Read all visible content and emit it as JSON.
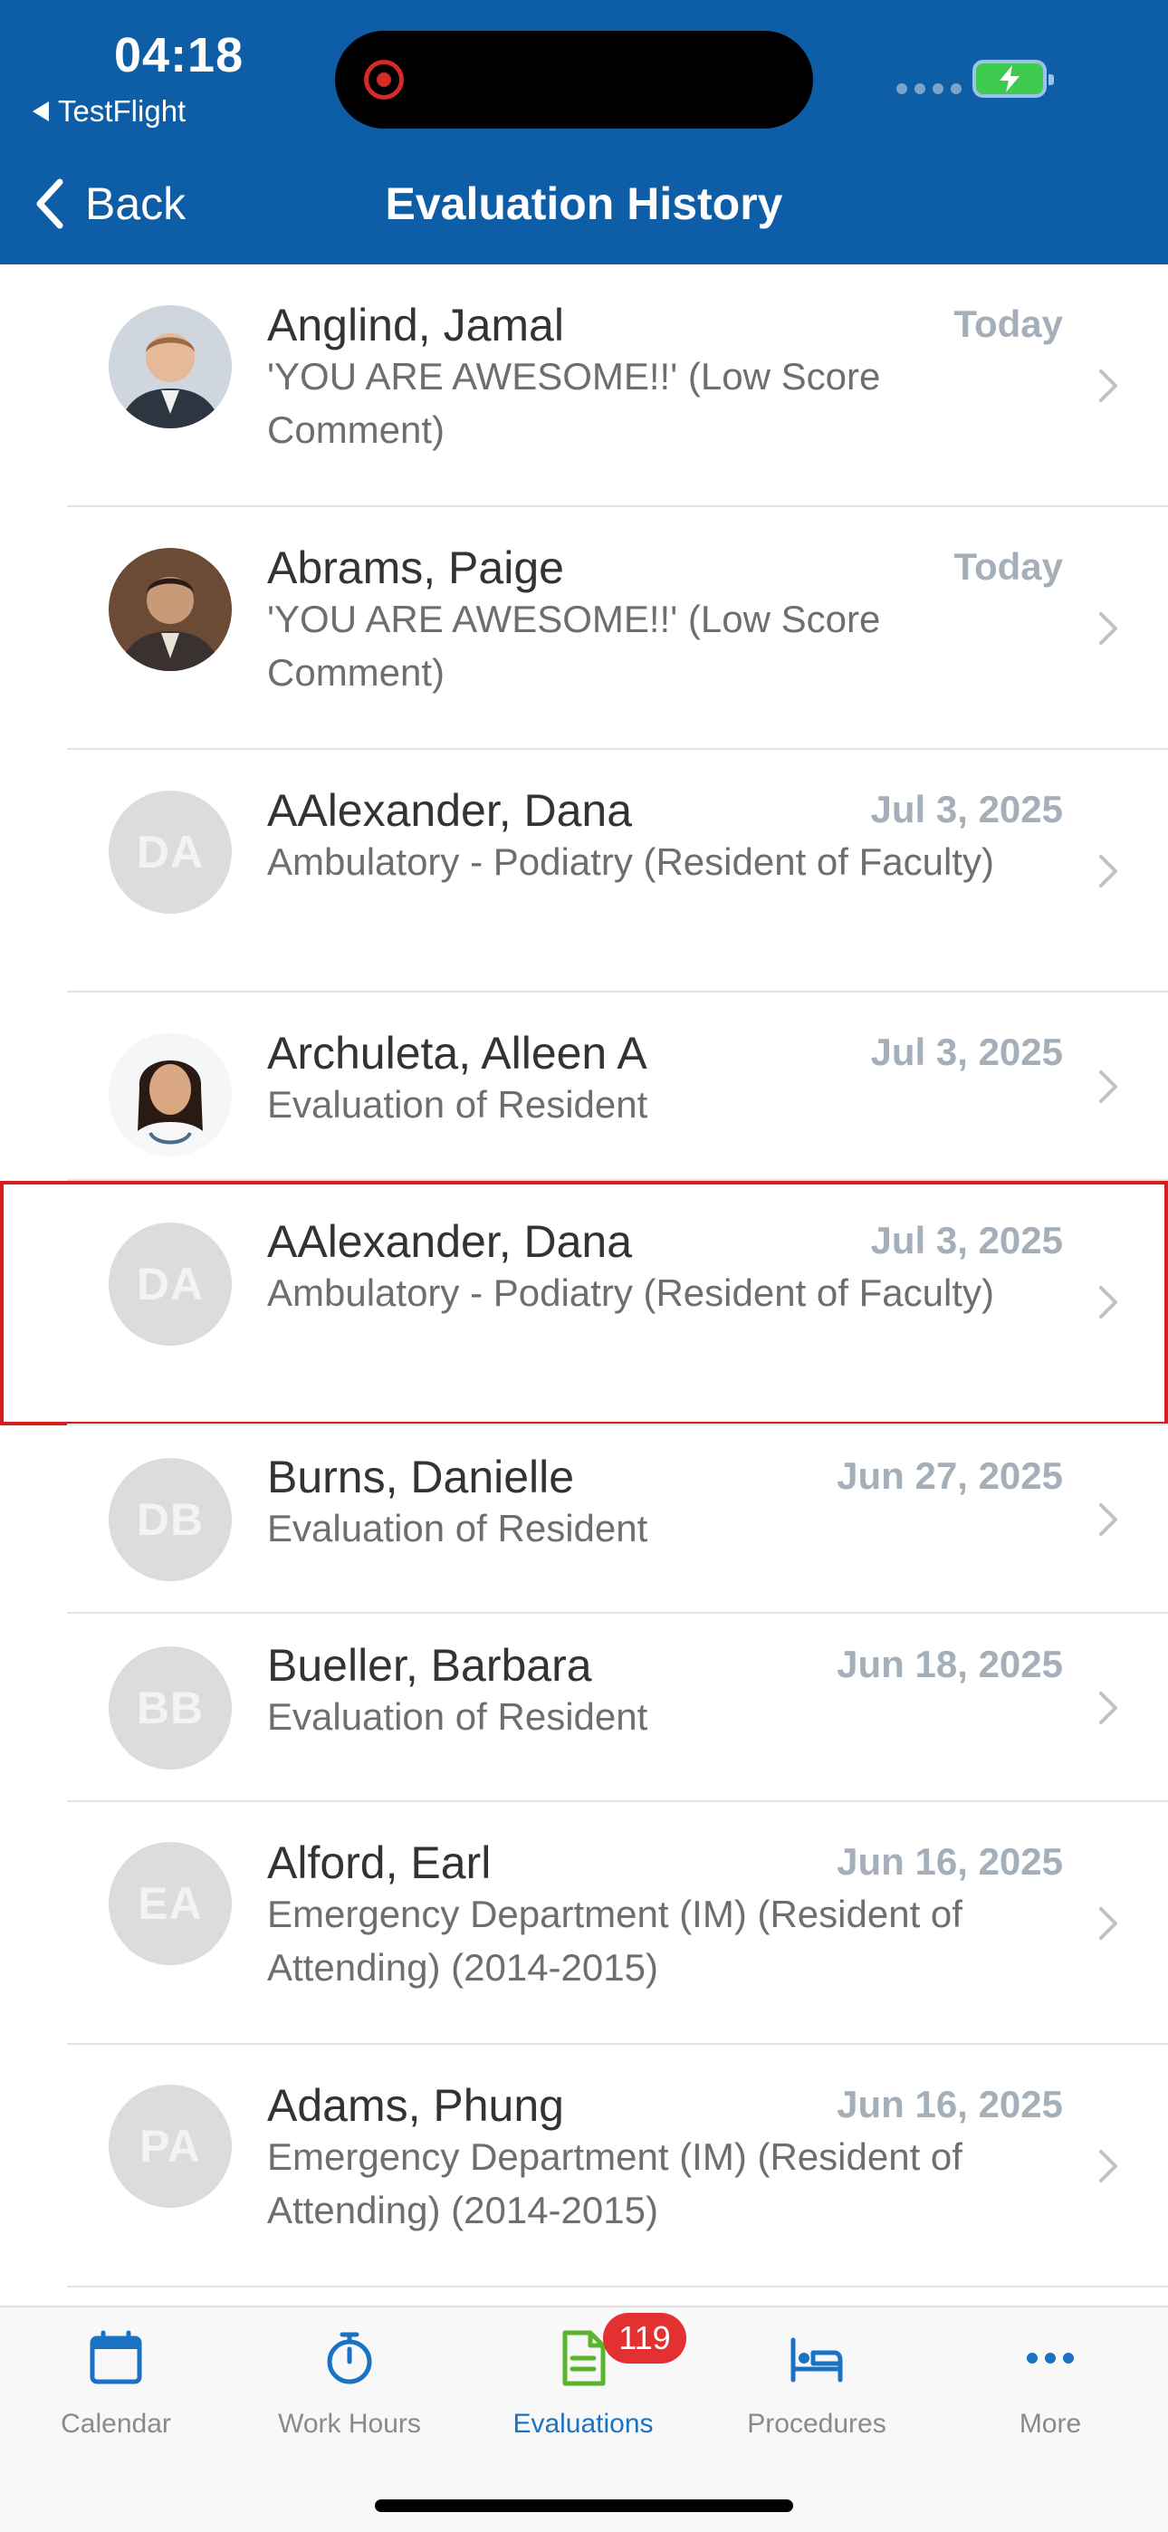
{
  "status_bar": {
    "time": "04:18",
    "back_app": "TestFlight"
  },
  "nav": {
    "back_label": "Back",
    "title": "Evaluation History"
  },
  "rows": [
    {
      "name": "Anglind, Jamal",
      "date": "Today",
      "subtitle": "'YOU ARE AWESOME!!'  (Low Score Comment)",
      "initials": "",
      "photo": "man-photo"
    },
    {
      "name": "Abrams, Paige",
      "date": "Today",
      "subtitle": "'YOU ARE AWESOME!!'  (Low Score Comment)",
      "initials": "",
      "photo": "man-photo"
    },
    {
      "name": "AAlexander, Dana",
      "date": "Jul 3, 2025",
      "subtitle": "Ambulatory - Podiatry (Resident of Faculty)",
      "initials": "DA"
    },
    {
      "name": "Archuleta, Alleen A",
      "date": "Jul 3, 2025",
      "subtitle": "Evaluation of Resident",
      "initials": "",
      "photo": "woman-photo"
    },
    {
      "name": "AAlexander, Dana",
      "date": "Jul 3, 2025",
      "subtitle": "Ambulatory - Podiatry (Resident of Faculty)",
      "initials": "DA"
    },
    {
      "name": "Burns, Danielle",
      "date": "Jun 27, 2025",
      "subtitle": "Evaluation of Resident",
      "initials": "DB"
    },
    {
      "name": "Bueller, Barbara",
      "date": "Jun 18, 2025",
      "subtitle": "Evaluation of Resident",
      "initials": "BB"
    },
    {
      "name": "Alford, Earl",
      "date": "Jun 16, 2025",
      "subtitle": "Emergency Department (IM) (Resident of Attending) (2014-2015)",
      "initials": "EA"
    },
    {
      "name": "Adams, Phung",
      "date": "Jun 16, 2025",
      "subtitle": "Emergency Department (IM) (Resident of Attending) (2014-2015)",
      "initials": "PA"
    }
  ],
  "tabs": [
    {
      "label": "Calendar",
      "icon": "calendar-icon"
    },
    {
      "label": "Work Hours",
      "icon": "stopwatch-icon"
    },
    {
      "label": "Evaluations",
      "icon": "document-icon",
      "badge": "119",
      "active": true
    },
    {
      "label": "Procedures",
      "icon": "bed-icon"
    },
    {
      "label": "More",
      "icon": "more-icon"
    }
  ],
  "colors": {
    "header": "#0d5ea6",
    "active_tab": "#1a72c4",
    "badge": "#e33131",
    "highlight": "#d81d1d",
    "date": "#a4afba"
  }
}
